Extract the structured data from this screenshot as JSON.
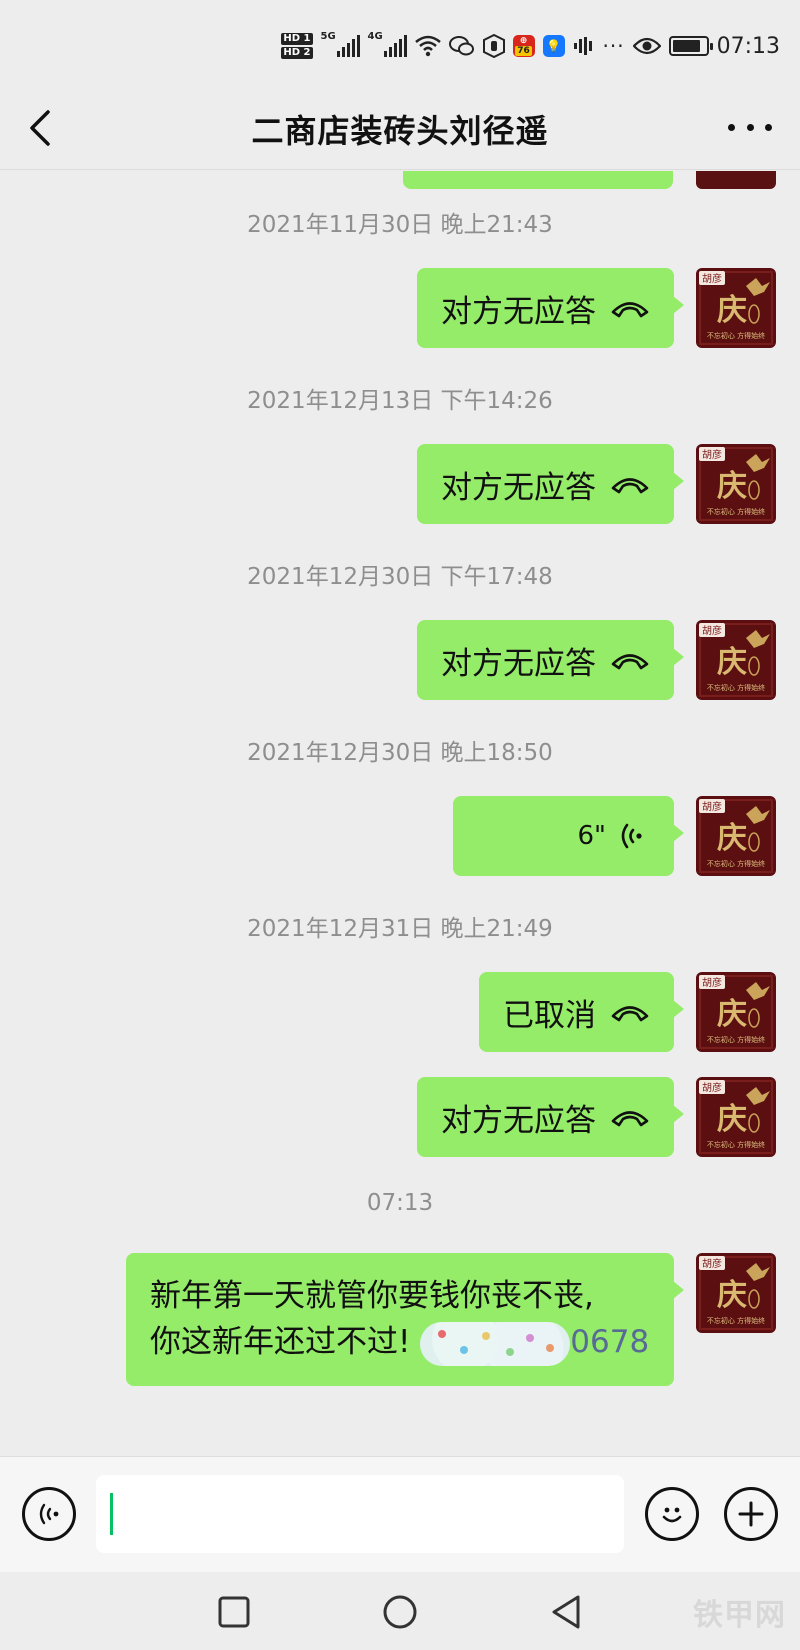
{
  "status_bar": {
    "time": "07:13",
    "hd1": "HD 1",
    "hd2": "HD 2",
    "signal1": "5G",
    "signal2": "4G",
    "badge_number": "76"
  },
  "header": {
    "title": "二商店装砖头刘径遥"
  },
  "messages": [
    {
      "type": "timestamp",
      "text": "2021年11月30日 晚上21:43"
    },
    {
      "type": "call",
      "text": "对方无应答"
    },
    {
      "type": "timestamp",
      "text": "2021年12月13日 下午14:26"
    },
    {
      "type": "call",
      "text": "对方无应答"
    },
    {
      "type": "timestamp",
      "text": "2021年12月30日 下午17:48"
    },
    {
      "type": "call",
      "text": "对方无应答"
    },
    {
      "type": "timestamp",
      "text": "2021年12月30日 晚上18:50"
    },
    {
      "type": "voice",
      "text": "6\""
    },
    {
      "type": "timestamp",
      "text": "2021年12月31日 晚上21:49"
    },
    {
      "type": "call",
      "text": "已取消"
    },
    {
      "type": "call",
      "text": "对方无应答"
    },
    {
      "type": "timestamp",
      "text": "07:13"
    },
    {
      "type": "text",
      "line1": "新年第一天就管你要钱你丧不丧,",
      "line2": "你这新年还过不过!",
      "tail": "0678"
    }
  ],
  "avatar": {
    "tag": "胡彦",
    "char": "庆",
    "motto": "不忘初心 方得始终"
  },
  "watermark": "铁甲网",
  "colors": {
    "bubble": "#95ec69",
    "background": "#ededed",
    "timestamp": "#8e8e8e",
    "link": "#576b95",
    "caret": "#07c160"
  }
}
